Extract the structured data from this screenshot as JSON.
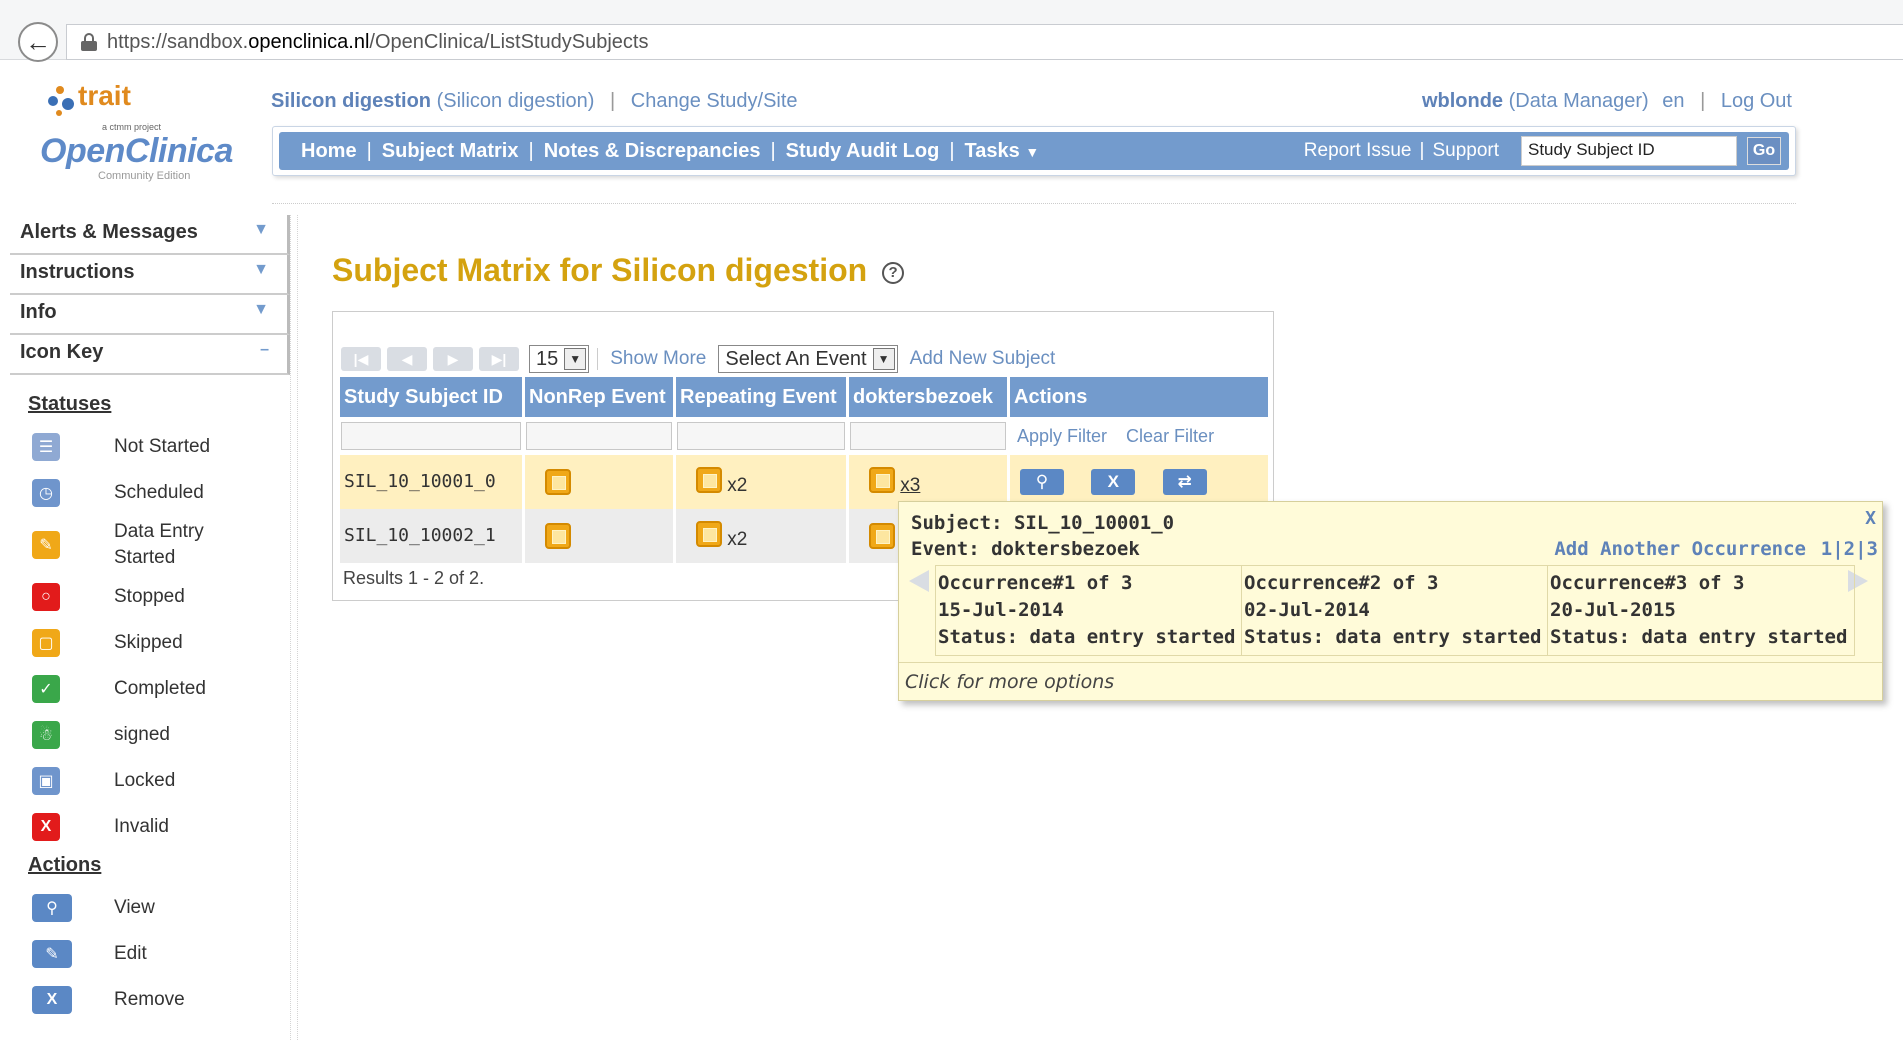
{
  "browser": {
    "url_prefix": "https://sandbox.",
    "url_host": "openclinica.nl",
    "url_path": "/OpenClinica/ListStudySubjects"
  },
  "brand": {
    "trait": "trait",
    "trait_sub": "a ctmm project",
    "product": "OpenClinica",
    "edition": "Community Edition"
  },
  "study": {
    "name": "Silicon digestion",
    "paren": "(Silicon digestion)",
    "change_link": "Change Study/Site"
  },
  "user": {
    "name": "wblonde",
    "role": "(Data Manager)",
    "lang": "en",
    "logout": "Log Out"
  },
  "nav": {
    "home": "Home",
    "subject_matrix": "Subject Matrix",
    "notes": "Notes & Discrepancies",
    "audit": "Study Audit Log",
    "tasks": "Tasks",
    "report_issue": "Report Issue",
    "support": "Support",
    "search_value": "Study Subject ID",
    "go": "Go"
  },
  "sidebar": {
    "sections": [
      "Alerts & Messages",
      "Instructions",
      "Info",
      "Icon Key"
    ],
    "statuses_title": "Statuses",
    "statuses": [
      {
        "label": "Not Started",
        "icon": "not-started-icon",
        "color": "#8fa9d3"
      },
      {
        "label": "Scheduled",
        "icon": "scheduled-icon",
        "color": "#6f95cc"
      },
      {
        "label": "Data Entry Started",
        "icon": "data-entry-started-icon",
        "color": "#f0a818"
      },
      {
        "label": "Stopped",
        "icon": "stopped-icon",
        "color": "#e21b1b"
      },
      {
        "label": "Skipped",
        "icon": "skipped-icon",
        "color": "#f0a818"
      },
      {
        "label": "Completed",
        "icon": "completed-icon",
        "color": "#3aa74a"
      },
      {
        "label": "signed",
        "icon": "signed-icon",
        "color": "#3aa74a"
      },
      {
        "label": "Locked",
        "icon": "locked-icon",
        "color": "#6f95cc"
      },
      {
        "label": "Invalid",
        "icon": "invalid-icon",
        "color": "#e21b1b"
      }
    ],
    "actions_title": "Actions",
    "actions": [
      {
        "label": "View",
        "icon": "magnifier-icon"
      },
      {
        "label": "Edit",
        "icon": "pencil-icon"
      },
      {
        "label": "Remove",
        "icon": "x-icon"
      }
    ]
  },
  "page": {
    "title": "Subject Matrix for Silicon digestion",
    "help": "?"
  },
  "toolbar": {
    "page_size": "15",
    "show_more": "Show More",
    "event_select": "Select An Event",
    "add_subject": "Add New Subject",
    "apply_filter": "Apply Filter",
    "clear_filter": "Clear Filter"
  },
  "table": {
    "headers": [
      "Study Subject ID",
      "NonRep Event",
      "Repeating Event",
      "doktersbezoek",
      "Actions"
    ],
    "rows": [
      {
        "id": "SIL_10_10001_0",
        "rep_count": "x2",
        "dok_count": "x3"
      },
      {
        "id": "SIL_10_10002_1",
        "rep_count": "x2",
        "dok_count": ""
      }
    ],
    "action_remove": "X",
    "results": "Results 1 - 2 of 2."
  },
  "popup": {
    "close": "X",
    "subject": "Subject: SIL_10_10001_0",
    "event": "Event: doktersbezoek",
    "add_occurrence": "Add Another Occurrence",
    "pages": "1|2|3",
    "occurrences": [
      {
        "title": "Occurrence#1 of 3",
        "date": "15-Jul-2014",
        "status": "Status: data entry started"
      },
      {
        "title": "Occurrence#2 of 3",
        "date": "02-Jul-2014",
        "status": "Status: data entry started"
      },
      {
        "title": "Occurrence#3 of 3",
        "date": "20-Jul-2015",
        "status": "Status: data entry started"
      }
    ],
    "footer": "Click for more options"
  }
}
